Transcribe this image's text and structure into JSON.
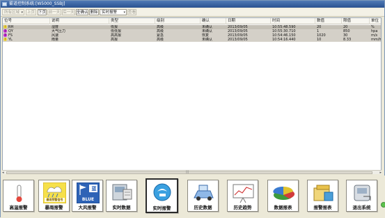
{
  "window": {
    "title": "雾道控制系统:[W5000_SSBJ]"
  },
  "toolbar": {
    "filter_select": "所有区域",
    "btn_prev_page": "上页",
    "btn_next_page": "下页",
    "btn_prev_item": "前一天",
    "btn_next_item": "后一天",
    "btn_confirm": "全确认",
    "btn_delete": "删除",
    "mode_select": "实时报警",
    "btn_query": "查看"
  },
  "table": {
    "columns": [
      "位号",
      "说明",
      "类型",
      "级别",
      "确认",
      "日期",
      "时间",
      "数值",
      "限值",
      "单位"
    ],
    "rows": [
      {
        "icon": "!",
        "icon_color": "#f2d437",
        "tag": "RH",
        "desc": "湿度",
        "type": "低报",
        "level": "高级",
        "ack": "未确认",
        "date": "2013/09/05",
        "time": "10:55:48.590",
        "value": "20",
        "limit": "20",
        "unit": "%"
      },
      {
        "icon": "?",
        "icon_color": "#c42bd6",
        "tag": "QY",
        "desc": "大气压力",
        "type": "低低报",
        "level": "高级",
        "ack": "未确认",
        "date": "2013/09/05",
        "time": "10:55:30.710",
        "value": "1",
        "limit": "850",
        "unit": "hpa"
      },
      {
        "icon": "?",
        "icon_color": "#c42bd6",
        "tag": "FS",
        "desc": "风速",
        "type": "高高报",
        "level": "紧急",
        "ack": "恢复",
        "date": "2013/09/05",
        "time": "10:54:46.150",
        "value": "1020",
        "limit": "30",
        "unit": "m/s"
      },
      {
        "icon": "!",
        "icon_color": "#f2d437",
        "tag": "YL",
        "desc": "雨量",
        "type": "高报",
        "level": "高级",
        "ack": "未确认",
        "date": "2013/09/05",
        "time": "10:54:16.440",
        "value": "10",
        "limit": "8.33",
        "unit": "mm/h"
      }
    ]
  },
  "nav": {
    "items": [
      {
        "label": "高温报警",
        "icon": "thermometer-icon"
      },
      {
        "label": "暴雨报警",
        "icon": "rainstorm-icon",
        "badge": "暴雨预警信号"
      },
      {
        "label": "大风报警",
        "icon": "wind-warning-icon",
        "badge": "BLUE",
        "badge_cn": "蓝"
      },
      {
        "label": "实时数据",
        "icon": "realtime-data-icon"
      },
      {
        "label": "实时报警",
        "icon": "realtime-alarm-icon"
      },
      {
        "label": "历史数据",
        "icon": "history-data-icon"
      },
      {
        "label": "历史趋势",
        "icon": "history-trend-icon"
      },
      {
        "label": "数据报表",
        "icon": "data-report-icon"
      },
      {
        "label": "报警报表",
        "icon": "alarm-report-icon"
      },
      {
        "label": "退出系统",
        "icon": "exit-icon"
      }
    ],
    "active_index": 4
  },
  "colors": {
    "titlebar": "#2a5291",
    "row_bg": "#d4d0c8",
    "warning_yellow": "#f2d437",
    "alarm_magenta": "#c42bd6",
    "wind_blue": "#2e63b6"
  }
}
